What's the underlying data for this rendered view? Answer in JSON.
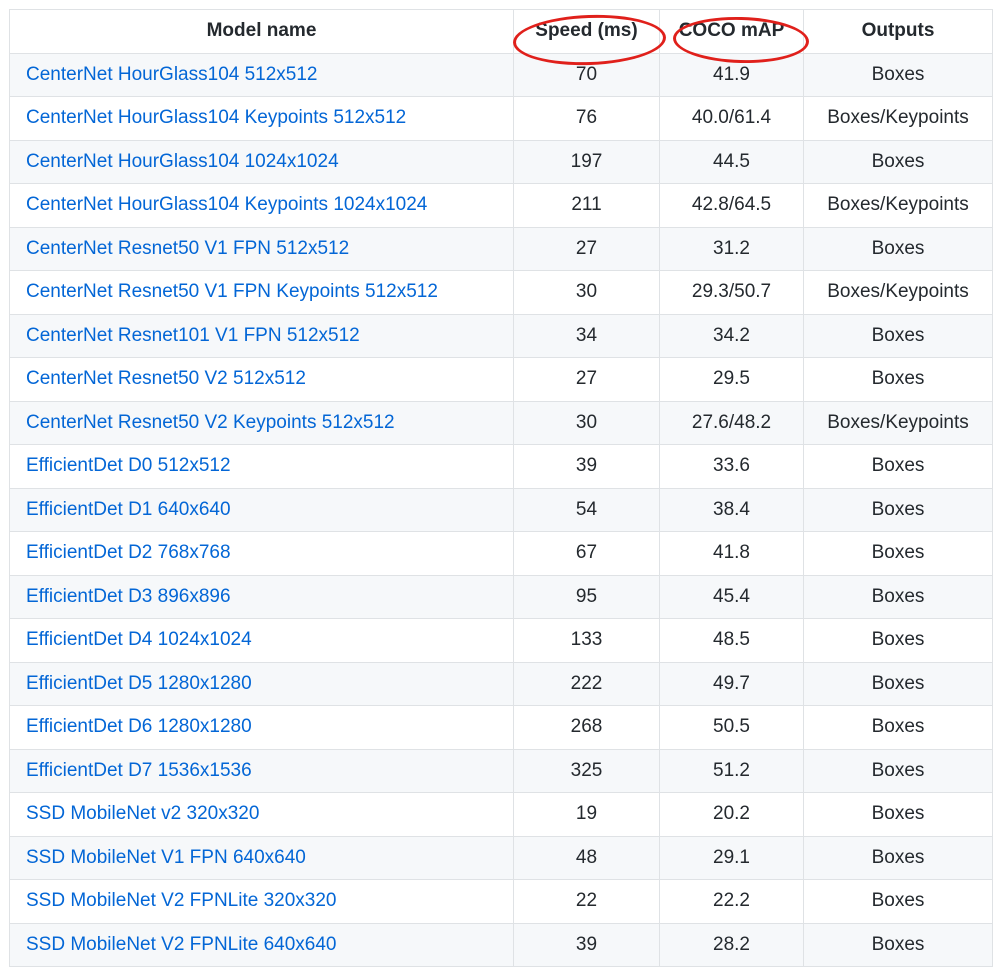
{
  "table": {
    "headers": {
      "model_name": "Model name",
      "speed": "Speed (ms)",
      "coco_map": "COCO mAP",
      "outputs": "Outputs"
    },
    "annotations": {
      "color": "#e0201b",
      "circled_columns": [
        "Speed (ms)",
        "COCO mAP"
      ]
    },
    "link_color": "#0366d6",
    "rows": [
      {
        "name": "CenterNet HourGlass104 512x512",
        "speed": "70",
        "map": "41.9",
        "outputs": "Boxes"
      },
      {
        "name": "CenterNet HourGlass104 Keypoints 512x512",
        "speed": "76",
        "map": "40.0/61.4",
        "outputs": "Boxes/Keypoints"
      },
      {
        "name": "CenterNet HourGlass104 1024x1024",
        "speed": "197",
        "map": "44.5",
        "outputs": "Boxes"
      },
      {
        "name": "CenterNet HourGlass104 Keypoints 1024x1024",
        "speed": "211",
        "map": "42.8/64.5",
        "outputs": "Boxes/Keypoints"
      },
      {
        "name": "CenterNet Resnet50 V1 FPN 512x512",
        "speed": "27",
        "map": "31.2",
        "outputs": "Boxes"
      },
      {
        "name": "CenterNet Resnet50 V1 FPN Keypoints 512x512",
        "speed": "30",
        "map": "29.3/50.7",
        "outputs": "Boxes/Keypoints"
      },
      {
        "name": "CenterNet Resnet101 V1 FPN 512x512",
        "speed": "34",
        "map": "34.2",
        "outputs": "Boxes"
      },
      {
        "name": "CenterNet Resnet50 V2 512x512",
        "speed": "27",
        "map": "29.5",
        "outputs": "Boxes"
      },
      {
        "name": "CenterNet Resnet50 V2 Keypoints 512x512",
        "speed": "30",
        "map": "27.6/48.2",
        "outputs": "Boxes/Keypoints"
      },
      {
        "name": "EfficientDet D0 512x512",
        "speed": "39",
        "map": "33.6",
        "outputs": "Boxes"
      },
      {
        "name": "EfficientDet D1 640x640",
        "speed": "54",
        "map": "38.4",
        "outputs": "Boxes"
      },
      {
        "name": "EfficientDet D2 768x768",
        "speed": "67",
        "map": "41.8",
        "outputs": "Boxes"
      },
      {
        "name": "EfficientDet D3 896x896",
        "speed": "95",
        "map": "45.4",
        "outputs": "Boxes"
      },
      {
        "name": "EfficientDet D4 1024x1024",
        "speed": "133",
        "map": "48.5",
        "outputs": "Boxes"
      },
      {
        "name": "EfficientDet D5 1280x1280",
        "speed": "222",
        "map": "49.7",
        "outputs": "Boxes"
      },
      {
        "name": "EfficientDet D6 1280x1280",
        "speed": "268",
        "map": "50.5",
        "outputs": "Boxes"
      },
      {
        "name": "EfficientDet D7 1536x1536",
        "speed": "325",
        "map": "51.2",
        "outputs": "Boxes"
      },
      {
        "name": "SSD MobileNet v2 320x320",
        "speed": "19",
        "map": "20.2",
        "outputs": "Boxes"
      },
      {
        "name": "SSD MobileNet V1 FPN 640x640",
        "speed": "48",
        "map": "29.1",
        "outputs": "Boxes"
      },
      {
        "name": "SSD MobileNet V2 FPNLite 320x320",
        "speed": "22",
        "map": "22.2",
        "outputs": "Boxes"
      },
      {
        "name": "SSD MobileNet V2 FPNLite 640x640",
        "speed": "39",
        "map": "28.2",
        "outputs": "Boxes"
      }
    ]
  }
}
